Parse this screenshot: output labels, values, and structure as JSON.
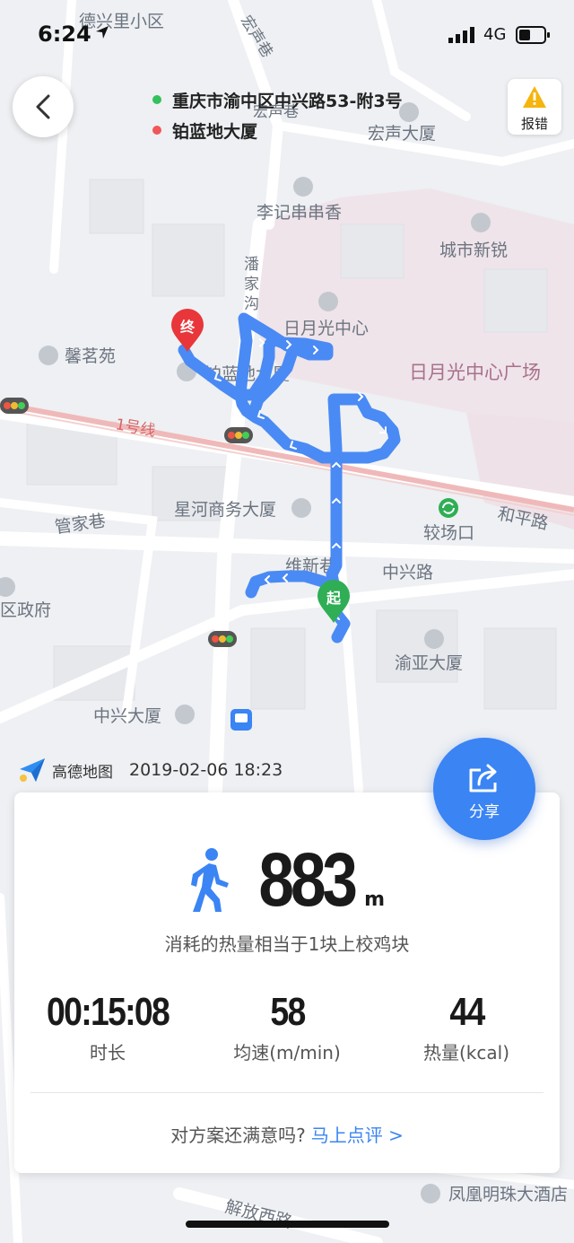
{
  "status_bar": {
    "time": "6:24",
    "network": "4G"
  },
  "route": {
    "start_address": "重庆市渝中区中兴路53-附3号",
    "end_address": "铂蓝地大厦",
    "start_marker": "起",
    "end_marker": "终"
  },
  "report_label": "报错",
  "share_label": "分享",
  "map": {
    "labels": [
      "德兴里小区",
      "宏声巷",
      "宏声大厦",
      "李记串串香",
      "城市新锐",
      "潘家沟",
      "日月光中心",
      "日月光中心广场",
      "馨茗苑",
      "铂蓝地大厦",
      "1号线",
      "星河商务大厦",
      "管家巷",
      "较场口",
      "和平路",
      "维新巷",
      "中兴路",
      "区政府",
      "渝亚大厦",
      "中兴大厦",
      "凤凰明珠大酒店",
      "解放西路"
    ],
    "brand": "高德地图",
    "timestamp": "2019-02-06 18:23"
  },
  "summary": {
    "distance_value": "883",
    "distance_unit": "m",
    "calorie_equiv": "消耗的热量相当于1块上校鸡块",
    "stats": [
      {
        "value": "00:15:08",
        "label": "时长"
      },
      {
        "value": "58",
        "label": "均速(m/min)"
      },
      {
        "value": "44",
        "label": "热量(kcal)"
      }
    ],
    "feedback_question": "对方案还满意吗?",
    "feedback_link": "马上点评 >"
  },
  "colors": {
    "route": "#4a8af4",
    "accent": "#3a84f4",
    "start_pin": "#2fae55",
    "end_pin": "#e8363a"
  },
  "icons": [
    "location-arrow-icon",
    "signal-icon",
    "battery-icon",
    "back-chevron-icon",
    "warning-icon",
    "share-icon",
    "walking-icon",
    "gaode-logo-icon",
    "metro-station-icon",
    "bus-stop-icon",
    "traffic-light-icon"
  ]
}
